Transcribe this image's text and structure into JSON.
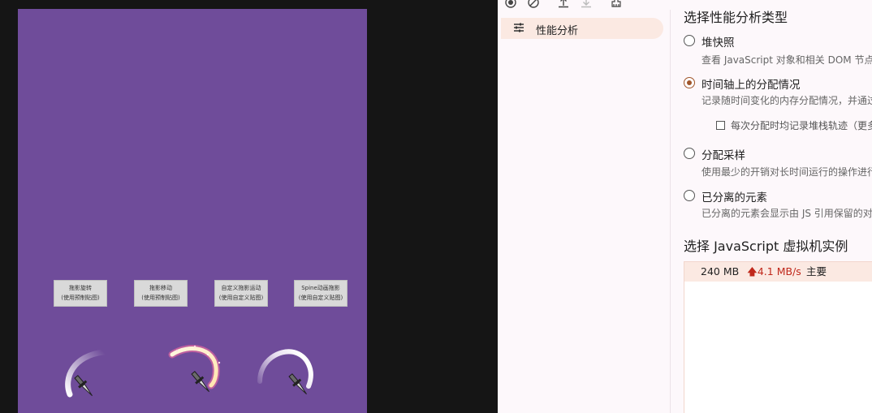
{
  "game": {
    "buttons": [
      {
        "line1": "拖影旋转",
        "line2": "(使用预制贴图)"
      },
      {
        "line1": "拖影移动",
        "line2": "(使用预制贴图)"
      },
      {
        "line1": "自定义拖影运动",
        "line2": "(使用自定义贴图)"
      },
      {
        "line1": "Spine动画拖影",
        "line2": "(使用自定义贴图)"
      }
    ]
  },
  "devtools": {
    "toolbar": {
      "icons": [
        "record-icon",
        "clear-icon",
        "upload-icon",
        "download-icon",
        "garbage-collect-icon"
      ]
    },
    "sidebar": {
      "items": [
        {
          "icon": "sliders-icon",
          "label": "性能分析"
        }
      ]
    },
    "main": {
      "heading": "选择性能分析类型",
      "options": [
        {
          "label": "堆快照",
          "desc": "查看 JavaScript 对象和相关 DOM 节点",
          "selected": false
        },
        {
          "label": "时间轴上的分配情况",
          "desc": "记录随时间变化的内存分配情况，并通过",
          "selected": true
        },
        {
          "label": "分配采样",
          "desc": "使用最少的开销对长时间运行的操作进行",
          "selected": false
        },
        {
          "label": "已分离的元素",
          "desc": "已分离的元素会显示由 JS 引用保留的对",
          "selected": false
        }
      ],
      "checkbox": {
        "label": "每次分配时均记录堆栈轨迹（更多开",
        "checked": false
      },
      "vm_heading": "选择 JavaScript 虚拟机实例",
      "vm": {
        "size": "240 MB",
        "rate": "4.1 MB/s",
        "name": "主要",
        "rate_color": "#c0281b"
      }
    }
  }
}
